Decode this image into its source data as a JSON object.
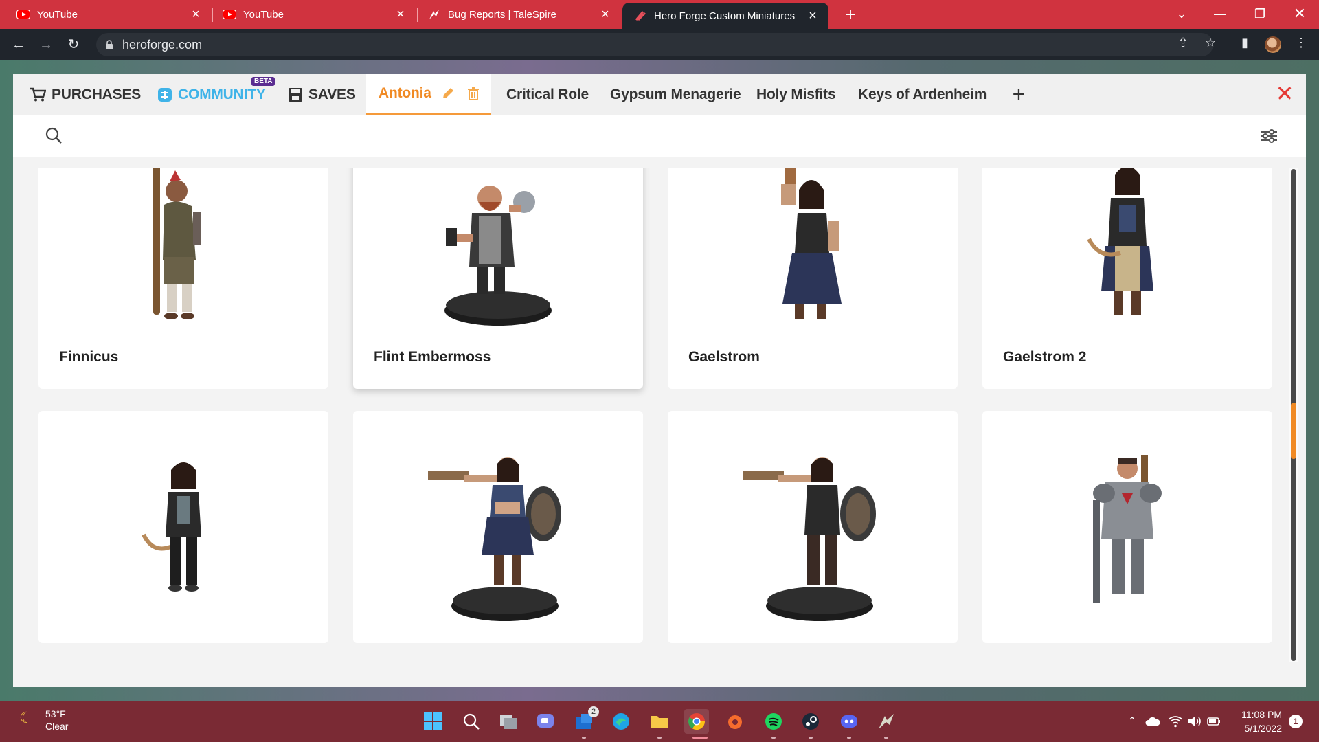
{
  "browser": {
    "tabs": [
      {
        "title": "YouTube",
        "icon": "youtube-icon"
      },
      {
        "title": "YouTube",
        "icon": "youtube-icon"
      },
      {
        "title": "Bug Reports | TaleSpire",
        "icon": "talespire-icon"
      },
      {
        "title": "Hero Forge Custom Miniatures",
        "icon": "heroforge-icon",
        "active": true
      }
    ],
    "url": "heroforge.com"
  },
  "nav": {
    "purchases": "PURCHASES",
    "community": "COMMUNITY",
    "beta": "BETA",
    "saves": "SAVES",
    "folders": [
      "Antonia",
      "Critical Role",
      "Gypsum Menagerie",
      "Holy Misfits",
      "Keys of Ardenheim"
    ],
    "active_folder": "Antonia"
  },
  "cards": [
    {
      "name": "Finnicus"
    },
    {
      "name": "Flint Embermoss"
    },
    {
      "name": "Gaelstrom"
    },
    {
      "name": "Gaelstrom 2"
    },
    {
      "name": ""
    },
    {
      "name": ""
    },
    {
      "name": ""
    },
    {
      "name": ""
    }
  ],
  "taskbar": {
    "temp": "53°F",
    "condition": "Clear",
    "time": "11:08 PM",
    "date": "5/1/2022",
    "mail_badge": "2",
    "notif_badge": "1"
  },
  "colors": {
    "tab_strip": "#d0333f",
    "accent_orange": "#f08a24",
    "community_blue": "#3fb3e8",
    "close_red": "#e53935"
  }
}
